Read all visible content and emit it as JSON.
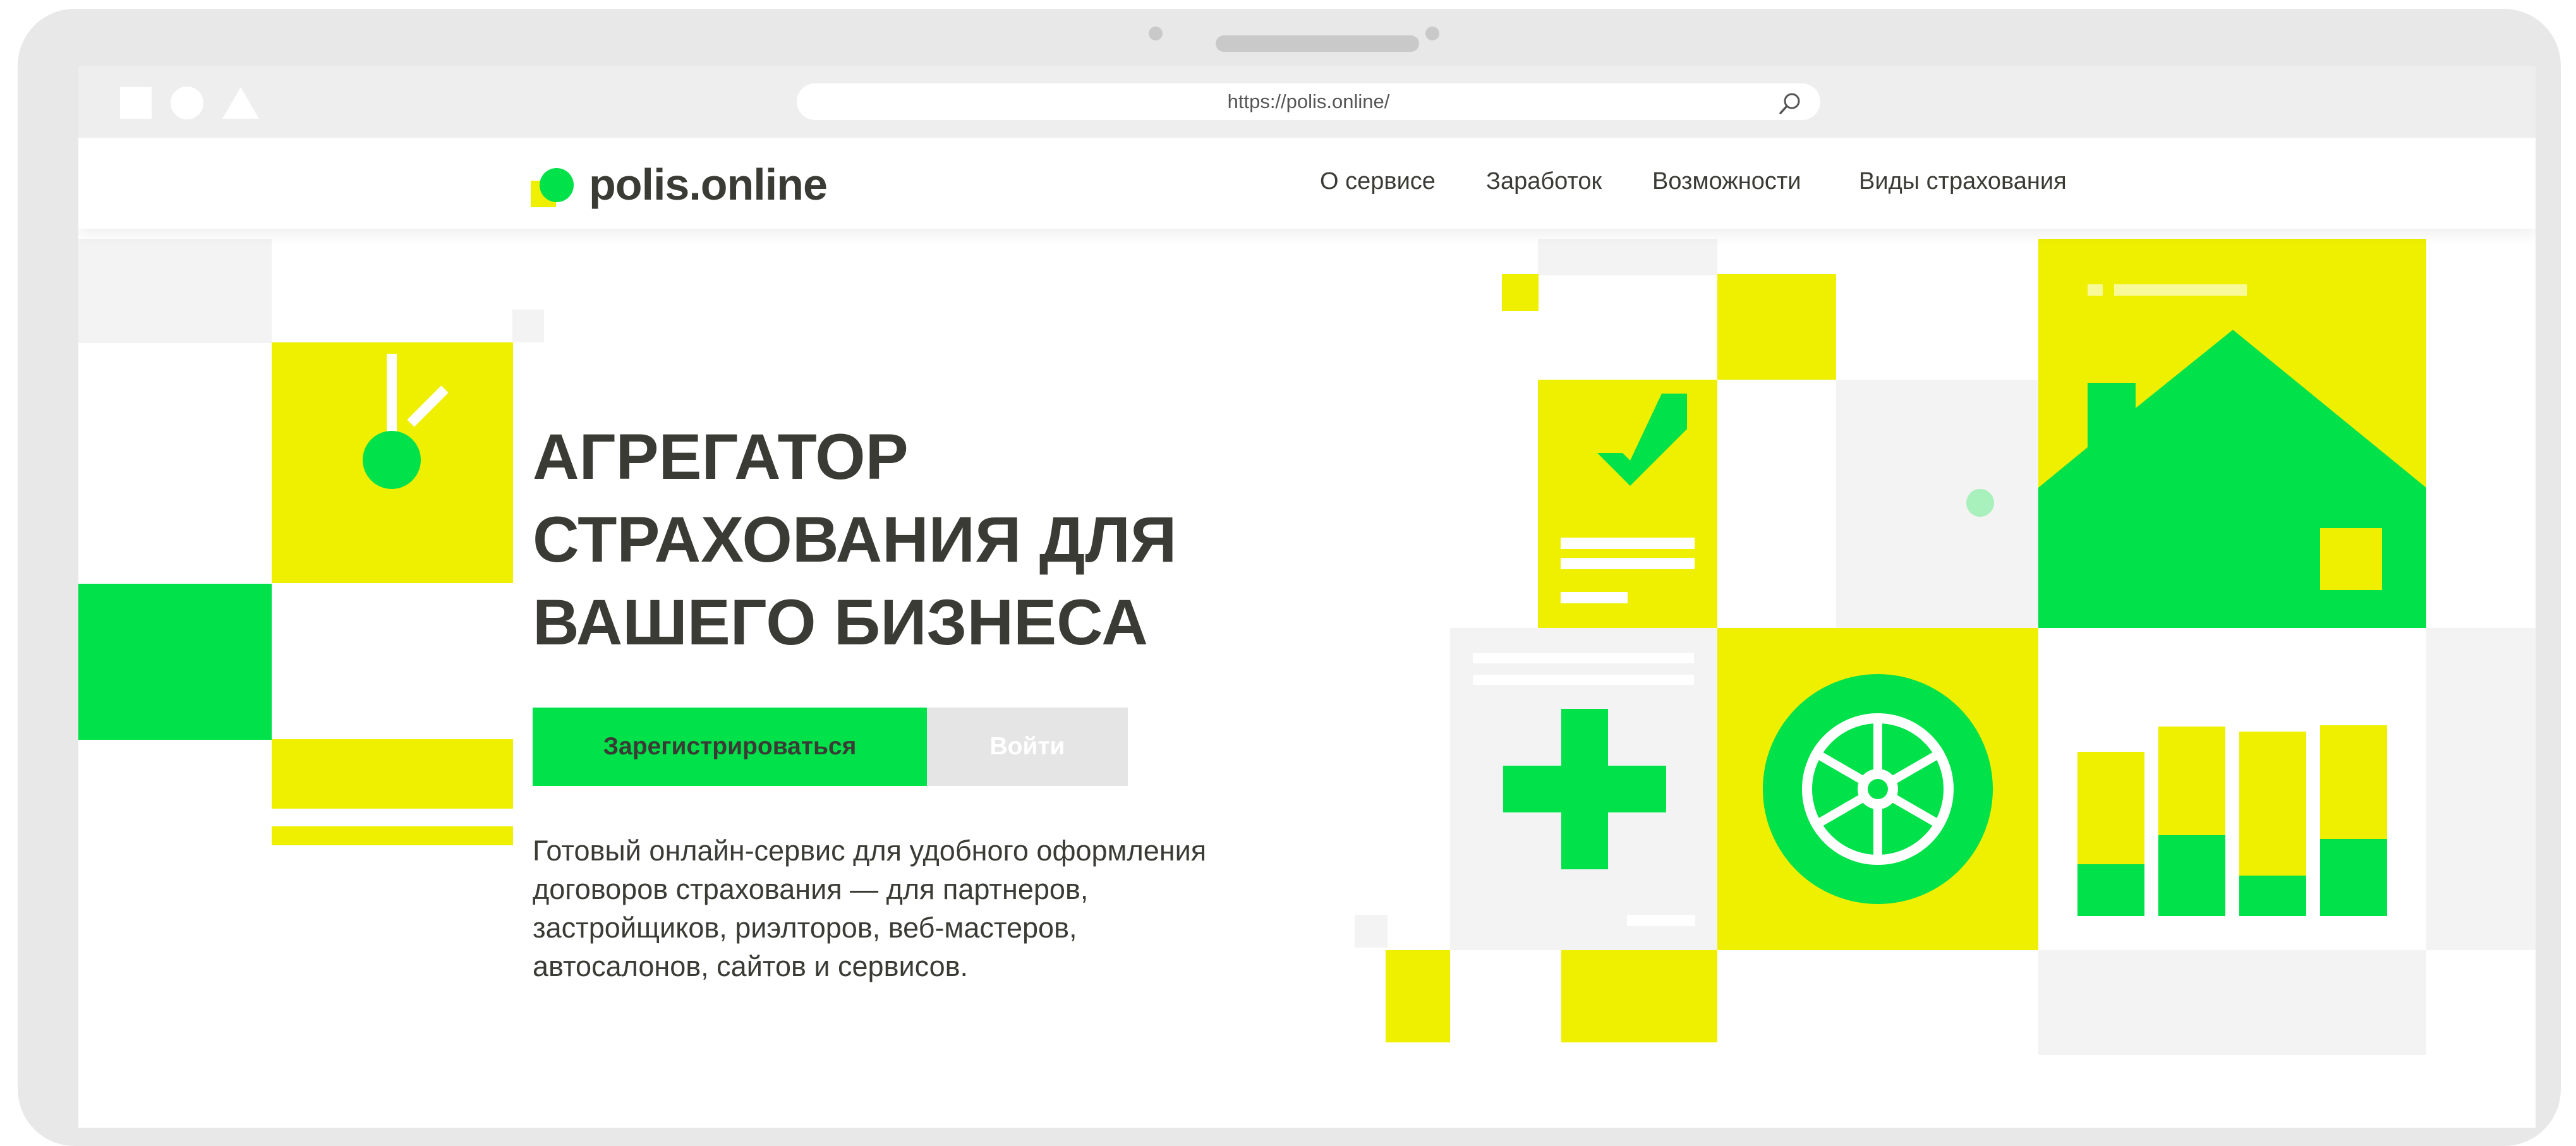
{
  "browser": {
    "url": "https://polis.online/"
  },
  "header": {
    "logo_text": "polis.online",
    "nav": [
      "О сервисе",
      "Заработок",
      "Возможности",
      "Виды страхования"
    ]
  },
  "hero": {
    "title_lines": [
      "АГРЕГАТОР",
      "СТРАХОВАНИЯ ДЛЯ",
      "ВАШЕГО БИЗНЕСА"
    ],
    "register_label": "Зарегистрироваться",
    "login_label": "Войти",
    "description_lines": [
      "Готовый онлайн-сервис для удобного оформления",
      "договоров страхования — для партнеров,",
      "застройщиков, риэлторов, веб-мастеров,",
      "автосалонов, сайтов и сервисов."
    ]
  },
  "illustrations": {
    "icons": [
      "clock-icon",
      "checkmark-document-icon",
      "house-icon",
      "medical-cross-icon",
      "wheel-icon",
      "bar-chart-icon"
    ]
  },
  "colors": {
    "brand_green": "#00e14a",
    "brand_yellow": "#eef000",
    "text_dark": "#3b3b35",
    "light_gray": "#f3f3f3"
  }
}
